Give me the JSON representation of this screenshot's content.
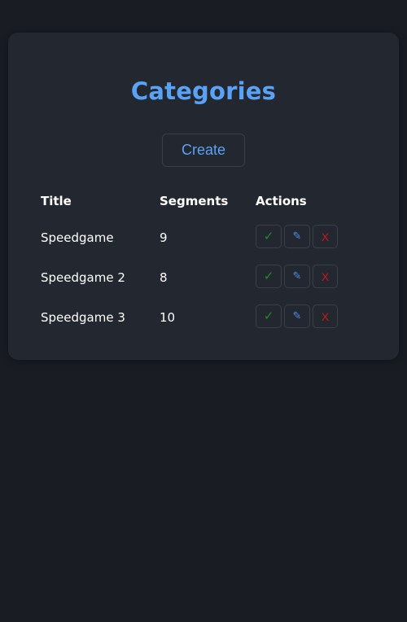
{
  "page": {
    "title": "Categories",
    "create_label": "Create"
  },
  "table": {
    "headers": [
      "Title",
      "Segments",
      "Actions"
    ],
    "rows": [
      {
        "title": "Speedgame",
        "segments": "9"
      },
      {
        "title": "Speedgame 2",
        "segments": "8"
      },
      {
        "title": "Speedgame 3",
        "segments": "10"
      }
    ],
    "actions": {
      "confirm_glyph": "✓",
      "edit_glyph": "✎",
      "delete_glyph": "X"
    }
  },
  "icons": {
    "confirm": "checkmark-icon",
    "edit": "pencil-icon",
    "delete": "close-icon"
  },
  "colors": {
    "background": "#191c23",
    "card": "#23272f",
    "accent": "#5aa2f5",
    "confirm": "#1e8c2e",
    "edit": "#4d8ff0",
    "delete": "#c21b1b"
  }
}
